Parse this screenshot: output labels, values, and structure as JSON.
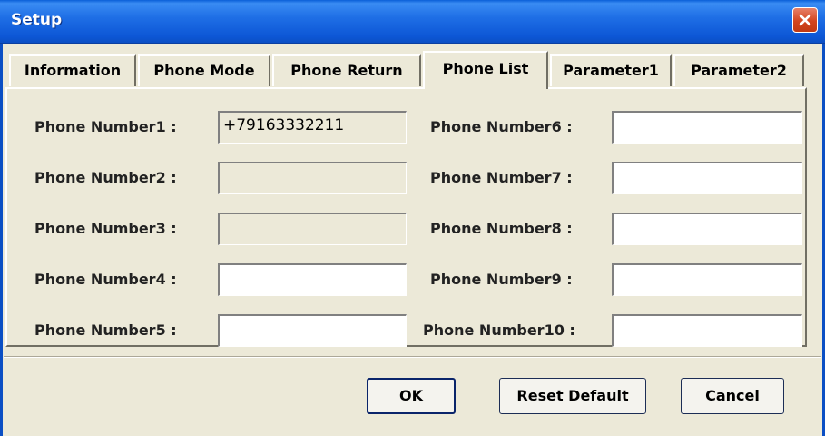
{
  "window": {
    "title": "Setup"
  },
  "tabs": [
    "Information",
    "Phone Mode",
    "Phone Return",
    "Phone List",
    "Parameter1",
    "Parameter2"
  ],
  "active_tab": "Phone List",
  "phone_list": {
    "left": [
      {
        "label": "Phone Number1 :",
        "value": "+79163332211",
        "enabled": false
      },
      {
        "label": "Phone Number2 :",
        "value": "",
        "enabled": false
      },
      {
        "label": "Phone Number3 :",
        "value": "",
        "enabled": false
      },
      {
        "label": "Phone Number4 :",
        "value": "",
        "enabled": true
      },
      {
        "label": "Phone Number5 :",
        "value": "",
        "enabled": true
      }
    ],
    "right": [
      {
        "label": "Phone Number6 :",
        "value": "",
        "enabled": true
      },
      {
        "label": "Phone Number7 :",
        "value": "",
        "enabled": true
      },
      {
        "label": "Phone Number8 :",
        "value": "",
        "enabled": true
      },
      {
        "label": "Phone Number9 :",
        "value": "",
        "enabled": true
      },
      {
        "label": "Phone Number10 :",
        "value": "",
        "enabled": true
      }
    ]
  },
  "buttons": {
    "ok": "OK",
    "reset": "Reset Default",
    "cancel": "Cancel"
  },
  "colors": {
    "titlebar": "#0b5ad6",
    "dialog_bg": "#ece9d8",
    "close_button": "#d2451f"
  }
}
